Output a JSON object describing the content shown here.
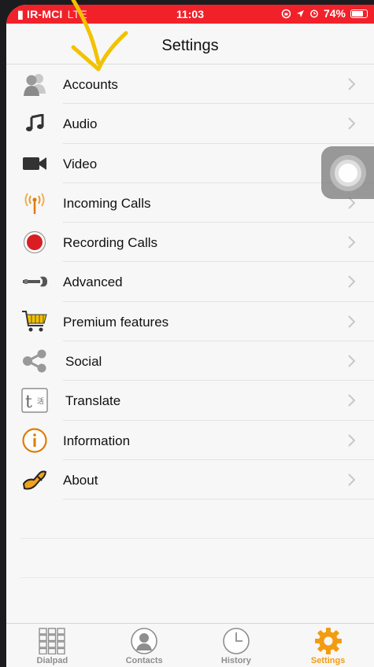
{
  "status_bar": {
    "carrier": "IR-MCI",
    "network": "LTE",
    "time": "11:03",
    "battery": "74%"
  },
  "header": {
    "title": "Settings"
  },
  "settings": [
    {
      "label": "Accounts",
      "icon": "accounts-icon"
    },
    {
      "label": "Audio",
      "icon": "music-note-icon"
    },
    {
      "label": "Video",
      "icon": "video-camera-icon"
    },
    {
      "label": "Incoming Calls",
      "icon": "antenna-icon"
    },
    {
      "label": "Recording Calls",
      "icon": "record-icon"
    },
    {
      "label": "Advanced",
      "icon": "wrench-icon"
    },
    {
      "label": "Premium features",
      "icon": "shopping-cart-icon"
    },
    {
      "label": "Social",
      "icon": "share-icon"
    },
    {
      "label": "Translate",
      "icon": "translate-icon"
    },
    {
      "label": "Information",
      "icon": "info-icon"
    },
    {
      "label": "About",
      "icon": "about-icon"
    }
  ],
  "tabs": [
    {
      "label": "Dialpad",
      "icon": "dialpad-icon",
      "active": false
    },
    {
      "label": "Contacts",
      "icon": "contacts-icon",
      "active": false
    },
    {
      "label": "History",
      "icon": "clock-icon",
      "active": false
    },
    {
      "label": "Settings",
      "icon": "gear-icon",
      "active": true
    }
  ],
  "colors": {
    "status_bar": "#f1212a",
    "accent": "#f39c12",
    "annotation": "#f2c200"
  }
}
